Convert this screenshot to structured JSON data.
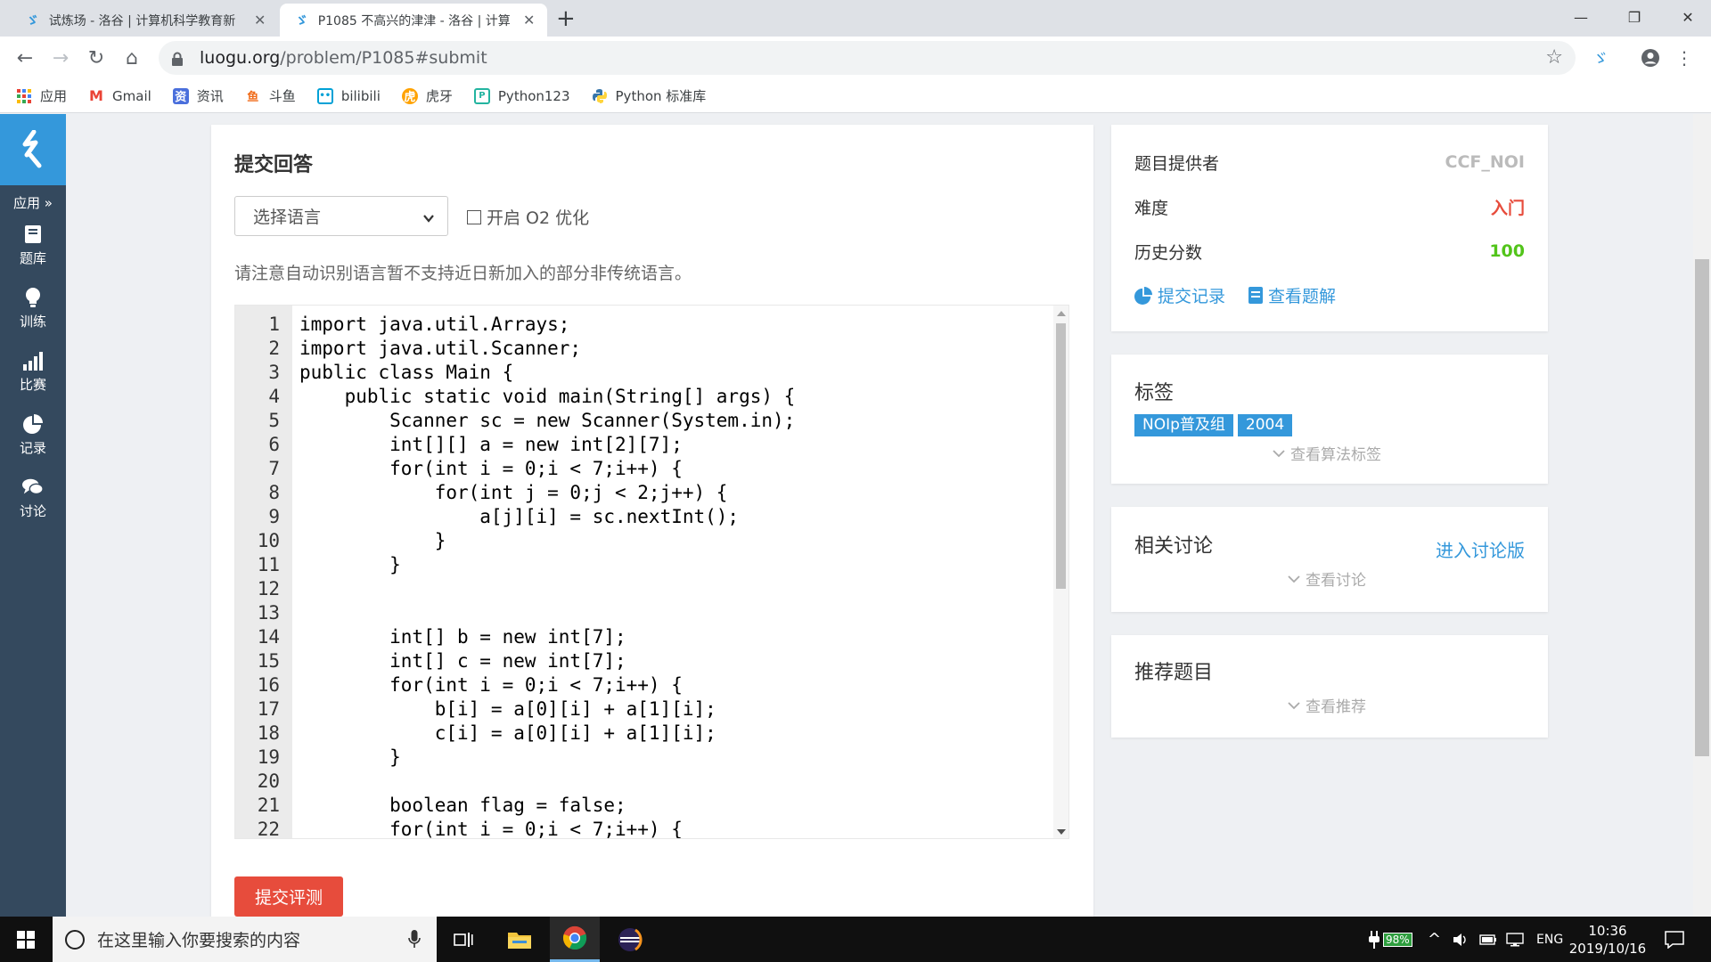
{
  "browser": {
    "tabs": [
      {
        "title": "试炼场 - 洛谷 | 计算机科学教育新",
        "active": false
      },
      {
        "title": "P1085 不高兴的津津 - 洛谷 | 计算",
        "active": true
      }
    ],
    "url_host": "luogu.org",
    "url_path": "/problem/P1085#submit",
    "bookmarks": [
      "应用",
      "Gmail",
      "资讯",
      "斗鱼",
      "bilibili",
      "虎牙",
      "Python123",
      "Python 标准库"
    ]
  },
  "sidebar": {
    "apps_label": "应用 »",
    "items": [
      {
        "label": "题库",
        "icon": "book-icon"
      },
      {
        "label": "训练",
        "icon": "lightbulb-icon"
      },
      {
        "label": "比赛",
        "icon": "signal-bars-icon"
      },
      {
        "label": "记录",
        "icon": "pie-chart-icon"
      },
      {
        "label": "讨论",
        "icon": "comments-icon"
      }
    ]
  },
  "submit": {
    "title": "提交回答",
    "language_placeholder": "选择语言",
    "o2_label": "开启 O2 优化",
    "notice": "请注意自动识别语言暂不支持近日新加入的部分非传统语言。",
    "button": "提交评测"
  },
  "code_lines": [
    "import java.util.Arrays;",
    "import java.util.Scanner;",
    "public class Main {",
    "    public static void main(String[] args) {",
    "        Scanner sc = new Scanner(System.in);",
    "        int[][] a = new int[2][7];",
    "        for(int i = 0;i < 7;i++) {",
    "            for(int j = 0;j < 2;j++) {",
    "                a[j][i] = sc.nextInt();",
    "            }",
    "        }",
    "",
    "",
    "        int[] b = new int[7];",
    "        int[] c = new int[7];",
    "        for(int i = 0;i < 7;i++) {",
    "            b[i] = a[0][i] + a[1][i];",
    "            c[i] = a[0][i] + a[1][i];",
    "        }",
    "",
    "        boolean flag = false;",
    "        for(int i = 0;i < 7;i++) {"
  ],
  "info": {
    "provider_label": "题目提供者",
    "provider_value": "CCF_NOI",
    "difficulty_label": "难度",
    "difficulty_value": "入门",
    "score_label": "历史分数",
    "score_value": "100",
    "records_link": "提交记录",
    "solution_link": "查看题解"
  },
  "tags_section": {
    "title": "标签",
    "tags": [
      "NOIp普及组",
      "2004"
    ],
    "more": "查看算法标签"
  },
  "discussion": {
    "title": "相关讨论",
    "link": "进入讨论版",
    "more": "查看讨论"
  },
  "recommend": {
    "title": "推荐题目",
    "more": "查看推荐"
  },
  "taskbar": {
    "search_placeholder": "在这里输入你要搜索的内容",
    "battery": "98%",
    "lang": "ENG",
    "time": "10:36",
    "date": "2019/10/16"
  },
  "colors": {
    "luogu_blue": "#3498db",
    "sidebar": "#34495e",
    "submit_red": "#e74c3c",
    "difficulty_red": "#e74c3c",
    "score_green": "#52c41a"
  }
}
